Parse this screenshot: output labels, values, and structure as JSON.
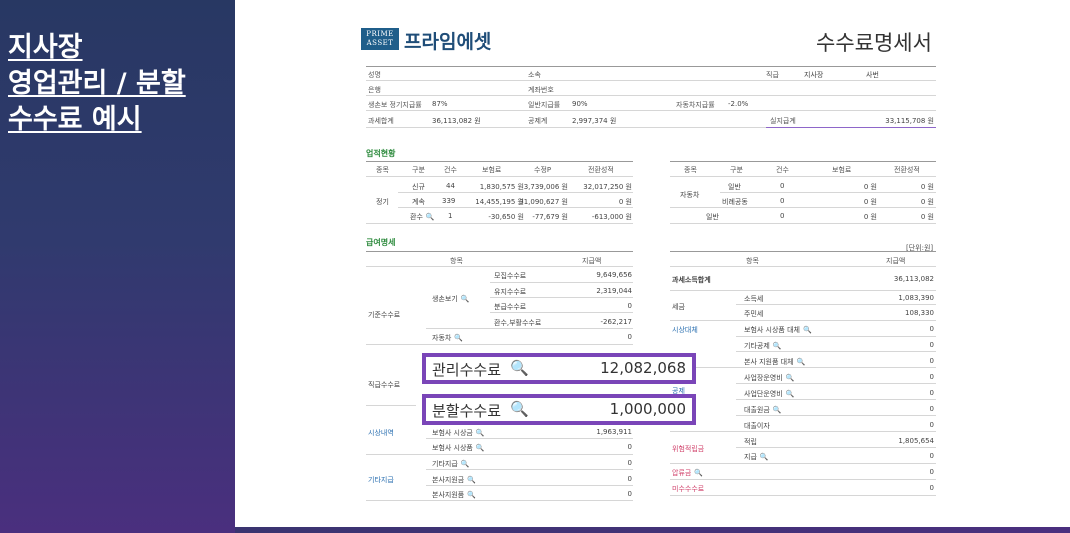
{
  "slide": {
    "title_lines": [
      "지사장",
      "영업관리 / 분할",
      "수수료 예시"
    ]
  },
  "header": {
    "logo": "PRIME ASSET",
    "brand": "프라임에셋",
    "doc_title": "수수료명세서"
  },
  "info": {
    "name_label": "성명",
    "affil_label": "소속",
    "rank_label": "직급",
    "rank_value1": "지사장",
    "rank_value2": "사번",
    "bank_label": "은행",
    "account_label": "계좌번호",
    "life_label": "생손보 정기지급률",
    "life_value": "87%",
    "general_label": "일반지급률",
    "general_value": "90%",
    "auto_label": "자동차지급률",
    "auto_value": "-2.0%",
    "tax_total_label": "과세합계",
    "tax_total_value": "36,113,082 원",
    "deduct_label": "공제계",
    "deduct_value": "2,997,374 원",
    "actual_label": "실지급계",
    "actual_value": "33,115,708 원"
  },
  "performance": {
    "title": "업적현황",
    "left_headers": [
      "종목",
      "구분",
      "건수",
      "보험료",
      "수정P",
      "전환성적"
    ],
    "left_group": "정기",
    "left_rows": [
      [
        "신규",
        "44",
        "1,830,575 원",
        "3,739,006 원",
        "32,017,250 원"
      ],
      [
        "계속",
        "339",
        "14,455,195 원",
        "31,090,627 원",
        "0 원"
      ],
      [
        "환수",
        "1",
        "-30,650 원",
        "-77,679 원",
        "-613,000 원"
      ]
    ],
    "right_headers": [
      "종목",
      "구분",
      "건수",
      "보험료",
      "전환성적"
    ],
    "right_group": "자동차",
    "right_rows": [
      [
        "일반",
        "0",
        "0 원",
        "0 원"
      ],
      [
        "비례공동",
        "0",
        "0 원",
        "0 원"
      ]
    ],
    "right_general_row": [
      "일반",
      "0",
      "0 원",
      "0 원"
    ]
  },
  "payment": {
    "title": "급여명세",
    "unit": "[단위:원]",
    "left_headers": [
      "항목",
      "지급액"
    ],
    "group_base": "기준수수료",
    "sub_life": "생손보기",
    "base_rows": [
      [
        "모집수수료",
        "9,649,656"
      ],
      [
        "유지수수료",
        "2,319,044"
      ],
      [
        "분급수수료",
        "0"
      ],
      [
        "환수,부활수수료",
        "-262,217"
      ]
    ],
    "auto_row": [
      "자동차",
      "0"
    ],
    "group_pay": "직급수수료",
    "group_market": "시상내역",
    "market_rows": [
      [
        "보험사 시상금",
        "1,963,911"
      ],
      [
        "보험사 시상품",
        "0"
      ]
    ],
    "group_other": "기타지급",
    "other_rows": [
      [
        "기타지급",
        "0"
      ],
      [
        "본사지원금",
        "0"
      ],
      [
        "본사지원품",
        "0"
      ]
    ],
    "right_headers": [
      "항목",
      "지급액"
    ],
    "tax_total_label": "과세소득합계",
    "tax_total_value": "36,113,082",
    "tax_group": "세금",
    "tax_rows": [
      [
        "소득세",
        "1,083,390"
      ],
      [
        "주민세",
        "108,330"
      ]
    ],
    "market_deduct_group": "시상대체",
    "market_deduct_rows": [
      [
        "보험사 시상품 대체",
        "0"
      ],
      [
        "기타공제",
        "0"
      ],
      [
        "본사 지원품 대체",
        "0"
      ]
    ],
    "loan_group": "공제",
    "loan_rows": [
      [
        "사업장운영비",
        "0"
      ],
      [
        "사업단운영비",
        "0"
      ],
      [
        "대출원금",
        "0"
      ],
      [
        "대출이자",
        "0"
      ]
    ],
    "hold_group": "위험적립금",
    "hold_rows": [
      [
        "적립",
        "1,805,654"
      ],
      [
        "지급",
        "0"
      ]
    ],
    "seized_label": "압류금",
    "seized_value": "0",
    "unpaid_label": "미수수수료",
    "unpaid_value": "0"
  },
  "highlights": {
    "mgmt_label": "관리수수료",
    "mgmt_value": "12,082,068",
    "split_label": "분할수수료",
    "split_value": "1,000,000"
  }
}
